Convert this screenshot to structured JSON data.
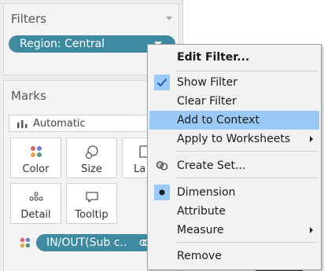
{
  "filters": {
    "title": "Filters",
    "pill_label": "Region: Central"
  },
  "marks": {
    "title": "Marks",
    "mark_type": "Automatic",
    "tiles": {
      "color": "Color",
      "size": "Size",
      "label": "La",
      "detail": "Detail",
      "tooltip": "Tooltip"
    },
    "field_pill": "IN/OUT(Sub c.."
  },
  "menu": {
    "items": [
      {
        "label": "Edit Filter..."
      },
      {
        "label": "Show Filter"
      },
      {
        "label": "Clear Filter"
      },
      {
        "label": "Add to Context"
      },
      {
        "label": "Apply to Worksheets"
      },
      {
        "label": "Create Set..."
      },
      {
        "label": "Dimension"
      },
      {
        "label": "Attribute"
      },
      {
        "label": "Measure"
      },
      {
        "label": "Remove"
      }
    ]
  },
  "colors": {
    "pill": "#3e8aa1",
    "highlight": "#99c9f7",
    "menu_bg": "#f2f2f2"
  }
}
